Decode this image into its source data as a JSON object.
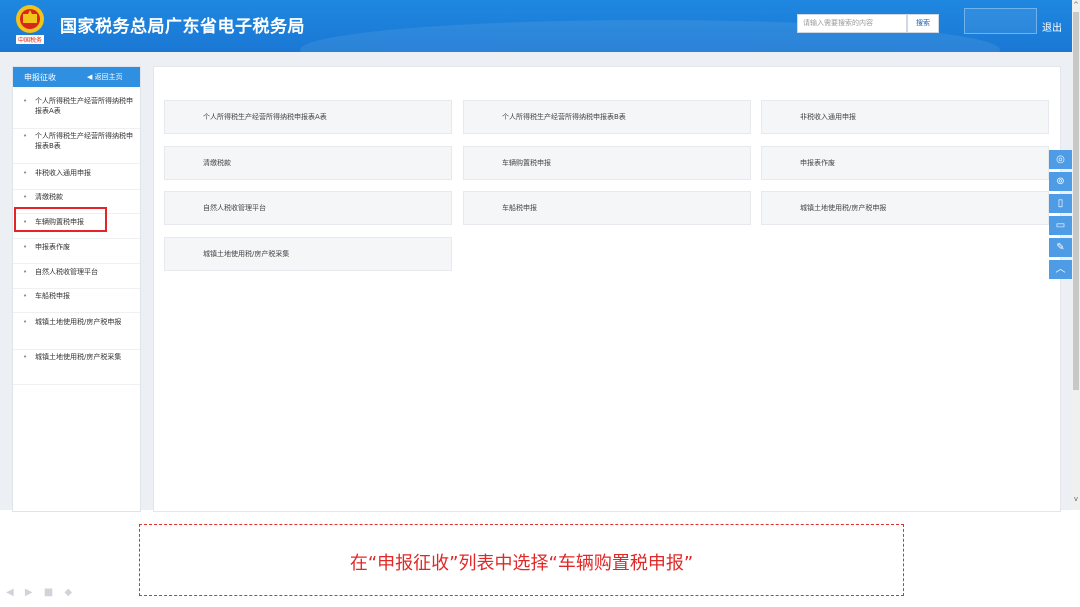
{
  "header": {
    "title": "国家税务总局广东省电子税务局",
    "search_placeholder": "请输入需要搜索的内容",
    "search_button": "搜索",
    "logout": "退出",
    "emblem_text": "中国税务"
  },
  "sidebar": {
    "title": "申报征收",
    "home_link": "返回主页",
    "items": [
      {
        "label": "个人所得税生产经营所得纳税申报表A表"
      },
      {
        "label": "个人所得税生产经营所得纳税申报表B表"
      },
      {
        "label": "非税收入通用申报"
      },
      {
        "label": "清缴税款"
      },
      {
        "label": "车辆购置税申报",
        "highlighted": true
      },
      {
        "label": "申报表作废"
      },
      {
        "label": "自然人税收管理平台"
      },
      {
        "label": "车船税申报"
      },
      {
        "label": "城镇土地使用税/房产税申报"
      },
      {
        "label": "城镇土地使用税/房产税采集"
      }
    ]
  },
  "content": {
    "cards": [
      "个人所得税生产经营所得纳税申报表A表",
      "个人所得税生产经营所得纳税申报表B表",
      "非税收入通用申报",
      "清缴税款",
      "车辆购置税申报",
      "申报表作废",
      "自然人税收管理平台",
      "车船税申报",
      "城镇土地使用税/房产税申报",
      "城镇土地使用税/房产税采集"
    ]
  },
  "side_tools": [
    "wechat-icon",
    "weibo-icon",
    "mobile-icon",
    "tablet-icon",
    "edit-icon",
    "back-to-top-icon"
  ],
  "caption": "在“申报征收”列表中选择“车辆购置税申报”",
  "colors": {
    "header_blue": "#1a78d4",
    "highlight_red": "#e3252a",
    "caption_red": "#e02828"
  }
}
